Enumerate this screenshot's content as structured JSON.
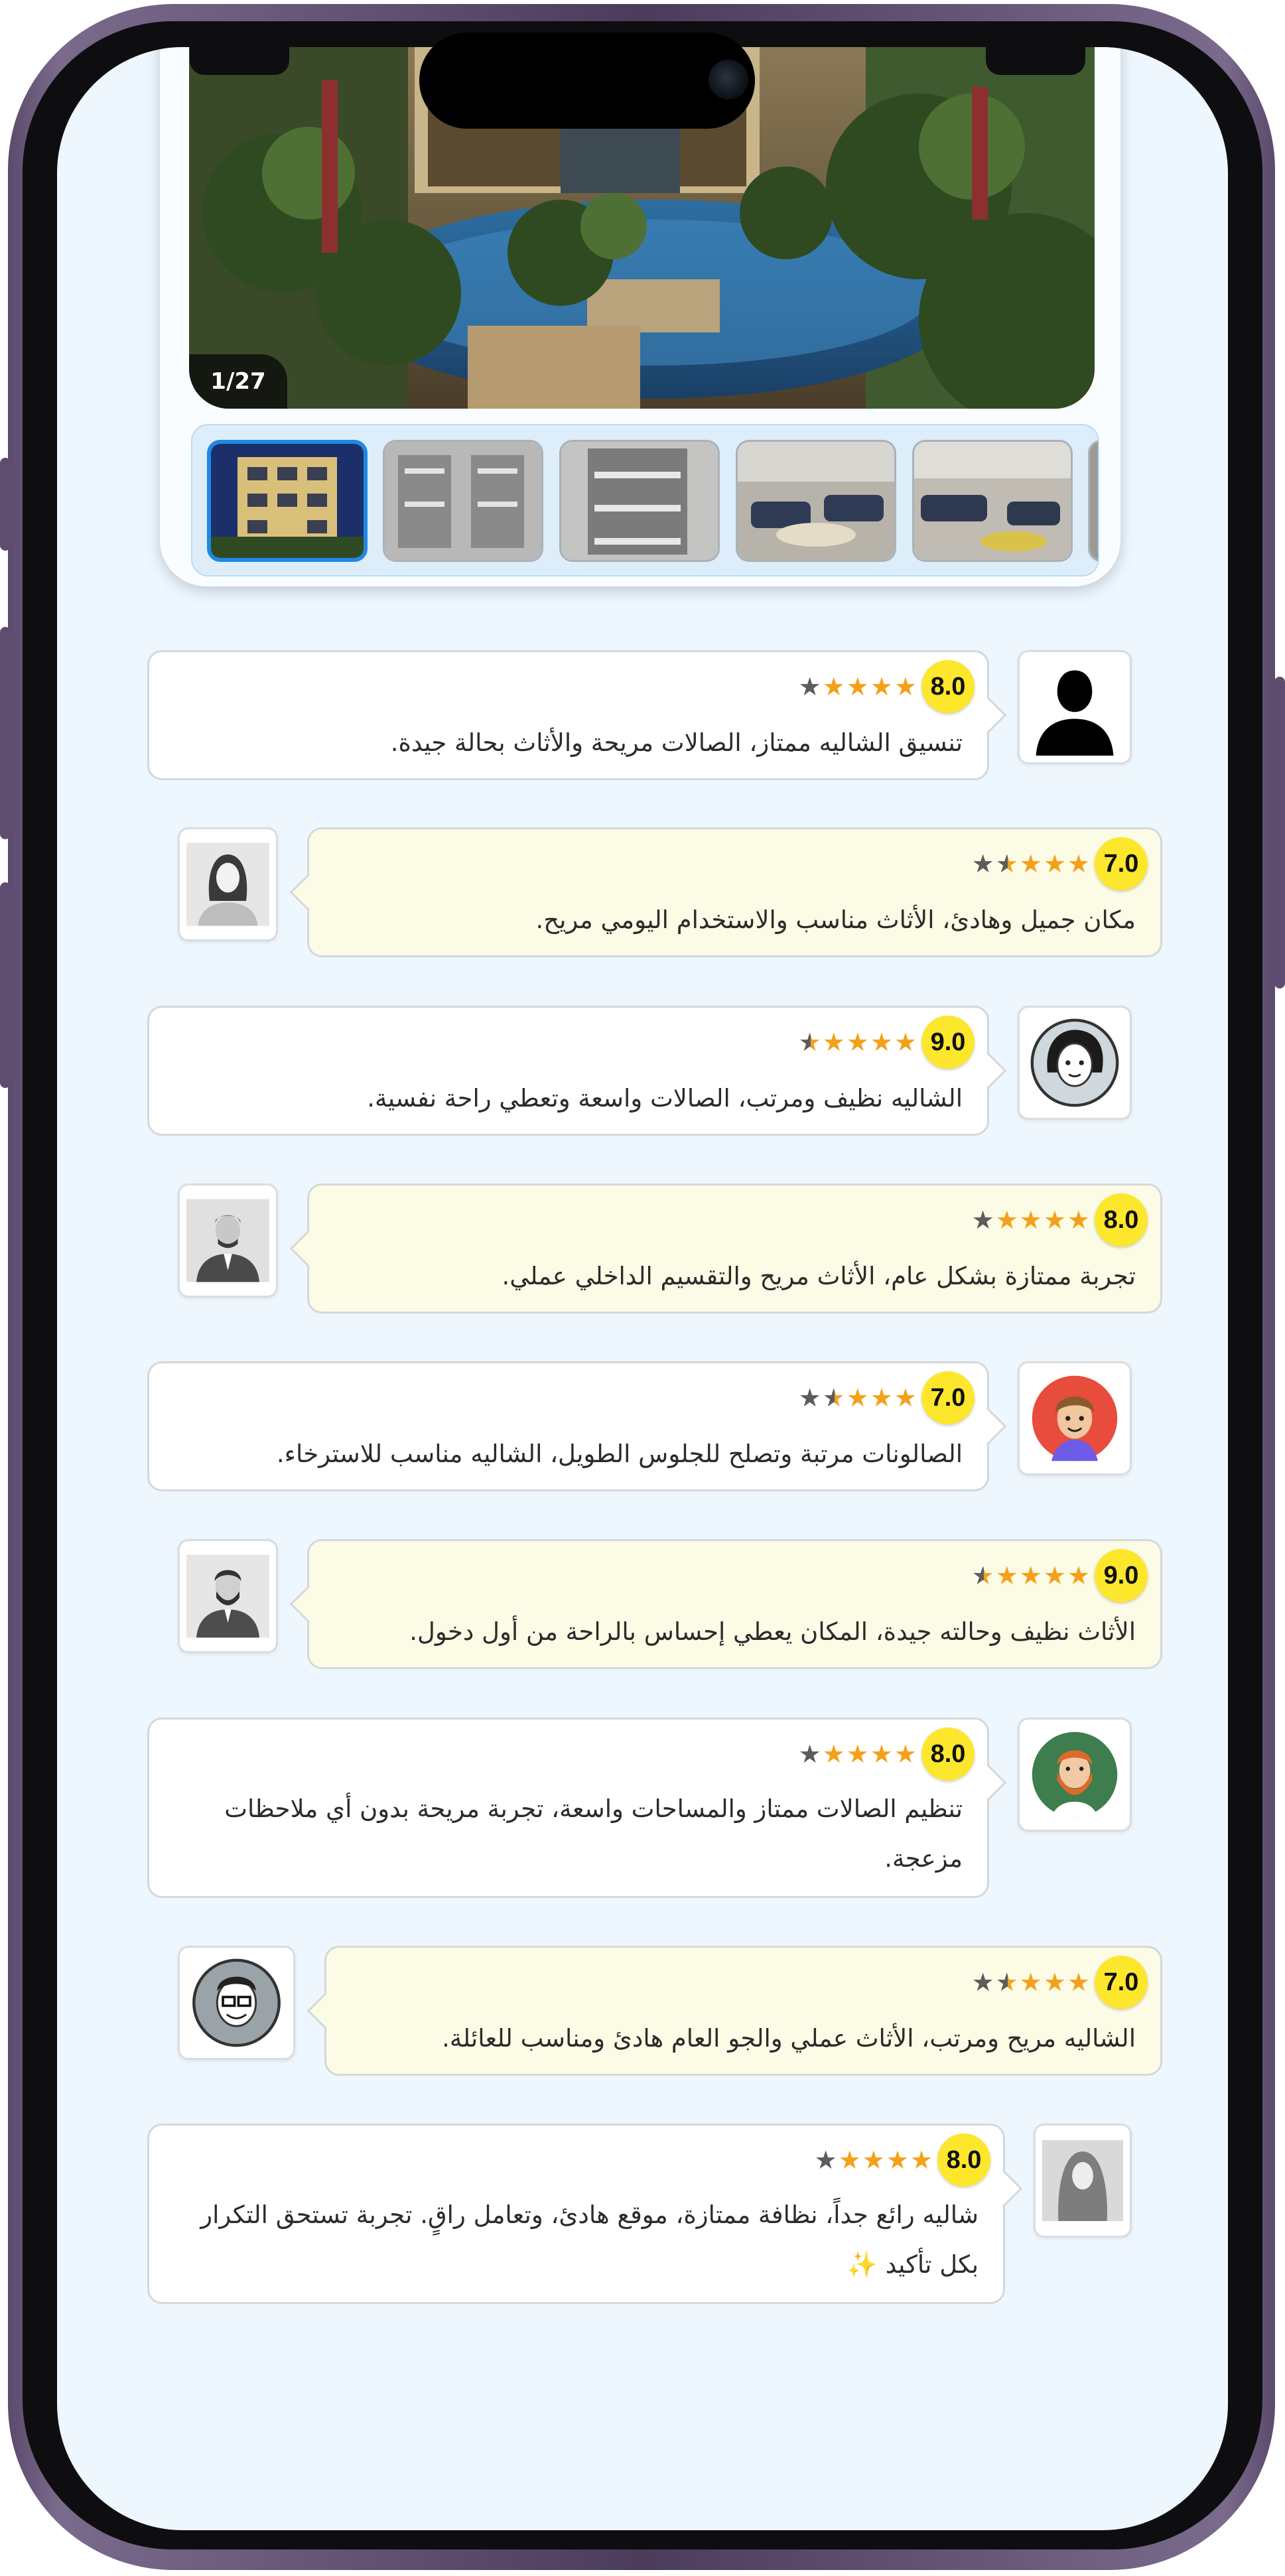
{
  "gallery": {
    "counter": "1/27",
    "thumbnails": [
      "building-facade-night",
      "balconies-facade",
      "balconies-side",
      "living-room-sofas",
      "living-room-wide"
    ]
  },
  "reviews": [
    {
      "score": "8.0",
      "stars": 4,
      "text": "تنسيق الشاليه ممتاز، الصالات مريحة والأثاث بحالة جيدة.",
      "style": "white",
      "avatar": "man-silhouette"
    },
    {
      "score": "7.0",
      "stars": 3.5,
      "text": "مكان جميل وهادئ، الأثاث مناسب والاستخدام اليومي مريح.",
      "style": "cream",
      "avatar": "woman-gray"
    },
    {
      "score": "9.0",
      "stars": 4.5,
      "text": "الشاليه نظيف ومرتب، الصالات واسعة وتعطي راحة نفسية.",
      "style": "white",
      "avatar": "woman-cartoon"
    },
    {
      "score": "8.0",
      "stars": 4,
      "text": "تجربة ممتازة بشكل عام، الأثاث مريح والتقسيم الداخلي عملي.",
      "style": "cream",
      "avatar": "man-gray-suit"
    },
    {
      "score": "7.0",
      "stars": 3.5,
      "text": "الصالونات مرتبة وتصلح للجلوس الطويل، الشاليه مناسب للاسترخاء.",
      "style": "white",
      "avatar": "boy-red"
    },
    {
      "score": "9.0",
      "stars": 4.5,
      "text": "الأثاث نظيف وحالته جيدة، المكان يعطي إحساس بالراحة من أول دخول.",
      "style": "cream",
      "avatar": "man-gray-beard"
    },
    {
      "score": "8.0",
      "stars": 4,
      "text": "تنظيم الصالات ممتاز والمساحات واسعة، تجربة مريحة بدون أي ملاحظات مزعجة.",
      "style": "white",
      "avatar": "man-ginger-beard"
    },
    {
      "score": "7.0",
      "stars": 3.5,
      "text": "الشاليه مريح ومرتب، الأثاث عملي والجو العام هادئ ومناسب للعائلة.",
      "style": "cream",
      "avatar": "man-glasses"
    },
    {
      "score": "8.0",
      "stars": 4,
      "text": "شاليه رائع جداً، نظافة ممتازة، موقع هادئ، وتعامل راقٍ. تجربة تستحق التكرار بكل تأكيد",
      "style": "white",
      "avatar": "woman-hijab",
      "emoji": "✨"
    }
  ]
}
